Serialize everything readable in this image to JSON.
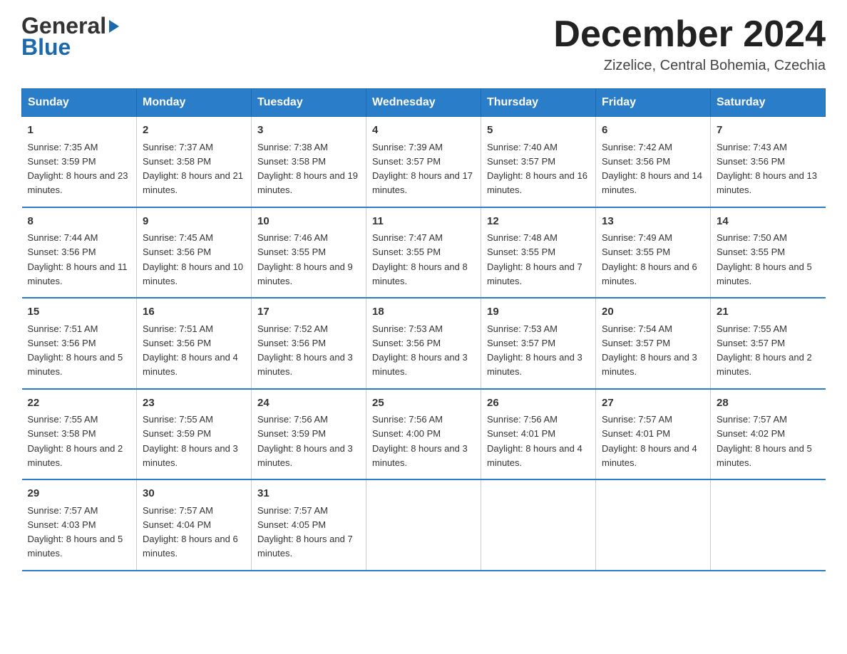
{
  "header": {
    "month_title": "December 2024",
    "location": "Zizelice, Central Bohemia, Czechia",
    "logo_line1": "General",
    "logo_line2": "Blue"
  },
  "days_of_week": [
    "Sunday",
    "Monday",
    "Tuesday",
    "Wednesday",
    "Thursday",
    "Friday",
    "Saturday"
  ],
  "weeks": [
    [
      {
        "day": "1",
        "sunrise": "7:35 AM",
        "sunset": "3:59 PM",
        "daylight": "8 hours and 23 minutes."
      },
      {
        "day": "2",
        "sunrise": "7:37 AM",
        "sunset": "3:58 PM",
        "daylight": "8 hours and 21 minutes."
      },
      {
        "day": "3",
        "sunrise": "7:38 AM",
        "sunset": "3:58 PM",
        "daylight": "8 hours and 19 minutes."
      },
      {
        "day": "4",
        "sunrise": "7:39 AM",
        "sunset": "3:57 PM",
        "daylight": "8 hours and 17 minutes."
      },
      {
        "day": "5",
        "sunrise": "7:40 AM",
        "sunset": "3:57 PM",
        "daylight": "8 hours and 16 minutes."
      },
      {
        "day": "6",
        "sunrise": "7:42 AM",
        "sunset": "3:56 PM",
        "daylight": "8 hours and 14 minutes."
      },
      {
        "day": "7",
        "sunrise": "7:43 AM",
        "sunset": "3:56 PM",
        "daylight": "8 hours and 13 minutes."
      }
    ],
    [
      {
        "day": "8",
        "sunrise": "7:44 AM",
        "sunset": "3:56 PM",
        "daylight": "8 hours and 11 minutes."
      },
      {
        "day": "9",
        "sunrise": "7:45 AM",
        "sunset": "3:56 PM",
        "daylight": "8 hours and 10 minutes."
      },
      {
        "day": "10",
        "sunrise": "7:46 AM",
        "sunset": "3:55 PM",
        "daylight": "8 hours and 9 minutes."
      },
      {
        "day": "11",
        "sunrise": "7:47 AM",
        "sunset": "3:55 PM",
        "daylight": "8 hours and 8 minutes."
      },
      {
        "day": "12",
        "sunrise": "7:48 AM",
        "sunset": "3:55 PM",
        "daylight": "8 hours and 7 minutes."
      },
      {
        "day": "13",
        "sunrise": "7:49 AM",
        "sunset": "3:55 PM",
        "daylight": "8 hours and 6 minutes."
      },
      {
        "day": "14",
        "sunrise": "7:50 AM",
        "sunset": "3:55 PM",
        "daylight": "8 hours and 5 minutes."
      }
    ],
    [
      {
        "day": "15",
        "sunrise": "7:51 AM",
        "sunset": "3:56 PM",
        "daylight": "8 hours and 5 minutes."
      },
      {
        "day": "16",
        "sunrise": "7:51 AM",
        "sunset": "3:56 PM",
        "daylight": "8 hours and 4 minutes."
      },
      {
        "day": "17",
        "sunrise": "7:52 AM",
        "sunset": "3:56 PM",
        "daylight": "8 hours and 3 minutes."
      },
      {
        "day": "18",
        "sunrise": "7:53 AM",
        "sunset": "3:56 PM",
        "daylight": "8 hours and 3 minutes."
      },
      {
        "day": "19",
        "sunrise": "7:53 AM",
        "sunset": "3:57 PM",
        "daylight": "8 hours and 3 minutes."
      },
      {
        "day": "20",
        "sunrise": "7:54 AM",
        "sunset": "3:57 PM",
        "daylight": "8 hours and 3 minutes."
      },
      {
        "day": "21",
        "sunrise": "7:55 AM",
        "sunset": "3:57 PM",
        "daylight": "8 hours and 2 minutes."
      }
    ],
    [
      {
        "day": "22",
        "sunrise": "7:55 AM",
        "sunset": "3:58 PM",
        "daylight": "8 hours and 2 minutes."
      },
      {
        "day": "23",
        "sunrise": "7:55 AM",
        "sunset": "3:59 PM",
        "daylight": "8 hours and 3 minutes."
      },
      {
        "day": "24",
        "sunrise": "7:56 AM",
        "sunset": "3:59 PM",
        "daylight": "8 hours and 3 minutes."
      },
      {
        "day": "25",
        "sunrise": "7:56 AM",
        "sunset": "4:00 PM",
        "daylight": "8 hours and 3 minutes."
      },
      {
        "day": "26",
        "sunrise": "7:56 AM",
        "sunset": "4:01 PM",
        "daylight": "8 hours and 4 minutes."
      },
      {
        "day": "27",
        "sunrise": "7:57 AM",
        "sunset": "4:01 PM",
        "daylight": "8 hours and 4 minutes."
      },
      {
        "day": "28",
        "sunrise": "7:57 AM",
        "sunset": "4:02 PM",
        "daylight": "8 hours and 5 minutes."
      }
    ],
    [
      {
        "day": "29",
        "sunrise": "7:57 AM",
        "sunset": "4:03 PM",
        "daylight": "8 hours and 5 minutes."
      },
      {
        "day": "30",
        "sunrise": "7:57 AM",
        "sunset": "4:04 PM",
        "daylight": "8 hours and 6 minutes."
      },
      {
        "day": "31",
        "sunrise": "7:57 AM",
        "sunset": "4:05 PM",
        "daylight": "8 hours and 7 minutes."
      },
      {
        "day": "",
        "sunrise": "",
        "sunset": "",
        "daylight": ""
      },
      {
        "day": "",
        "sunrise": "",
        "sunset": "",
        "daylight": ""
      },
      {
        "day": "",
        "sunrise": "",
        "sunset": "",
        "daylight": ""
      },
      {
        "day": "",
        "sunrise": "",
        "sunset": "",
        "daylight": ""
      }
    ]
  ],
  "labels": {
    "sunrise": "Sunrise:",
    "sunset": "Sunset:",
    "daylight": "Daylight:"
  }
}
